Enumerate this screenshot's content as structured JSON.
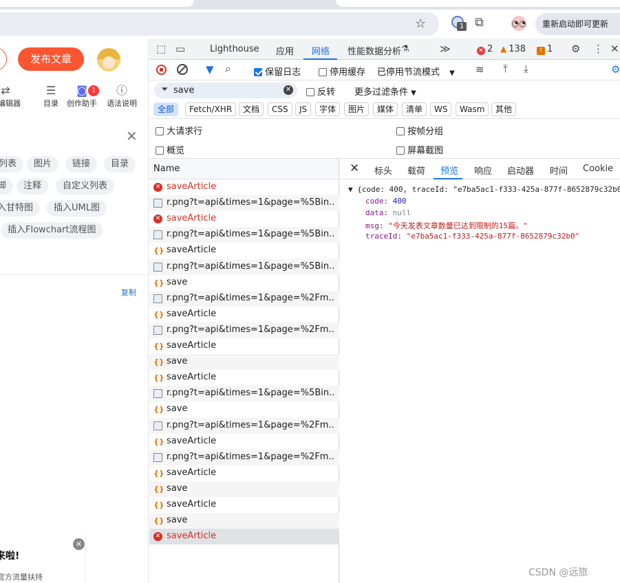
{
  "browser": {
    "extension_badge": "1",
    "update_label": "重新启动即可更新"
  },
  "editor": {
    "publish_label": "发布文章",
    "toolbar": [
      {
        "label": "本编辑器",
        "icon": "switch-icon"
      },
      {
        "label": "目录",
        "icon": "toc-icon"
      },
      {
        "label": "创作助手",
        "icon": "robot-icon"
      },
      {
        "label": "语法说明",
        "icon": "help-icon"
      }
    ],
    "assistant_badge": "1",
    "chips": [
      "列表",
      "图片",
      "链接",
      "目录",
      "脚",
      "注释",
      "自定义列表",
      "入甘特图",
      "插入UML图",
      "插入Flowchart流程图"
    ],
    "copy_label": "复制",
    "promo_title": "来啦!",
    "promo_sub": "官方流量扶持"
  },
  "devtools": {
    "tabs": [
      "Lighthouse",
      "应用",
      "网络",
      "性能数据分析"
    ],
    "active_tab": "网络",
    "errors": "2",
    "warnings": "138",
    "issues": "1",
    "toolbar": {
      "preserve_log": "保留日志",
      "disable_cache": "停用缓存",
      "throttle": "已停用节流模式"
    },
    "filter": {
      "value": "save",
      "invert": "反转",
      "more_filters": "更多过滤条件"
    },
    "types": [
      "全部",
      "Fetch/XHR",
      "文档",
      "CSS",
      "JS",
      "字体",
      "图片",
      "媒体",
      "清单",
      "WS",
      "Wasm",
      "其他"
    ],
    "options": {
      "big_rows": "大请求行",
      "group_by_frame": "按帧分组",
      "overview": "概览",
      "screenshots": "屏幕截图"
    },
    "list_header": "Name",
    "requests": [
      {
        "name": "saveArticle",
        "type": "err"
      },
      {
        "name": "r.png?t=api&times=1&page=%5Bin...",
        "type": "img"
      },
      {
        "name": "saveArticle",
        "type": "err"
      },
      {
        "name": "r.png?t=api&times=1&page=%5Bin...",
        "type": "img"
      },
      {
        "name": "saveArticle",
        "type": "js"
      },
      {
        "name": "r.png?t=api&times=1&page=%5Bin...",
        "type": "img"
      },
      {
        "name": "save",
        "type": "js"
      },
      {
        "name": "r.png?t=api&times=1&page=%2Fm...",
        "type": "img"
      },
      {
        "name": "saveArticle",
        "type": "js"
      },
      {
        "name": "r.png?t=api&times=1&page=%2Fm...",
        "type": "img"
      },
      {
        "name": "saveArticle",
        "type": "js"
      },
      {
        "name": "save",
        "type": "js"
      },
      {
        "name": "saveArticle",
        "type": "js"
      },
      {
        "name": "r.png?t=api&times=1&page=%5Bin...",
        "type": "img"
      },
      {
        "name": "save",
        "type": "js"
      },
      {
        "name": "r.png?t=api&times=1&page=%2Fm...",
        "type": "img"
      },
      {
        "name": "saveArticle",
        "type": "js"
      },
      {
        "name": "r.png?t=api&times=1&page=%2Fm...",
        "type": "img"
      },
      {
        "name": "saveArticle",
        "type": "js"
      },
      {
        "name": "save",
        "type": "js"
      },
      {
        "name": "saveArticle",
        "type": "js"
      },
      {
        "name": "save",
        "type": "js"
      },
      {
        "name": "saveArticle",
        "type": "err"
      }
    ],
    "detail_tabs": [
      "标头",
      "载荷",
      "预览",
      "响应",
      "启动器",
      "时间",
      "Cookie"
    ],
    "active_detail_tab": "预览",
    "preview": {
      "summary": "▼ {code: 400, traceId: \"e7ba5ac1-f333-425a-877f-8652879c32b0\"",
      "code_key": "code:",
      "code_val": "400",
      "data_key": "data:",
      "data_val": "null",
      "msg_key": "msg:",
      "msg_val": "\"今天发表文章数量已达到限制的15篇。\"",
      "trace_key": "traceId:",
      "trace_val": "\"e7ba5ac1-f333-425a-877f-8652879c32b0\""
    }
  },
  "watermark": "CSDN @远旅",
  "colors": {
    "accent": "#1a73e8",
    "brand": "#fc5531",
    "error": "#d93025",
    "warning": "#e37400"
  }
}
